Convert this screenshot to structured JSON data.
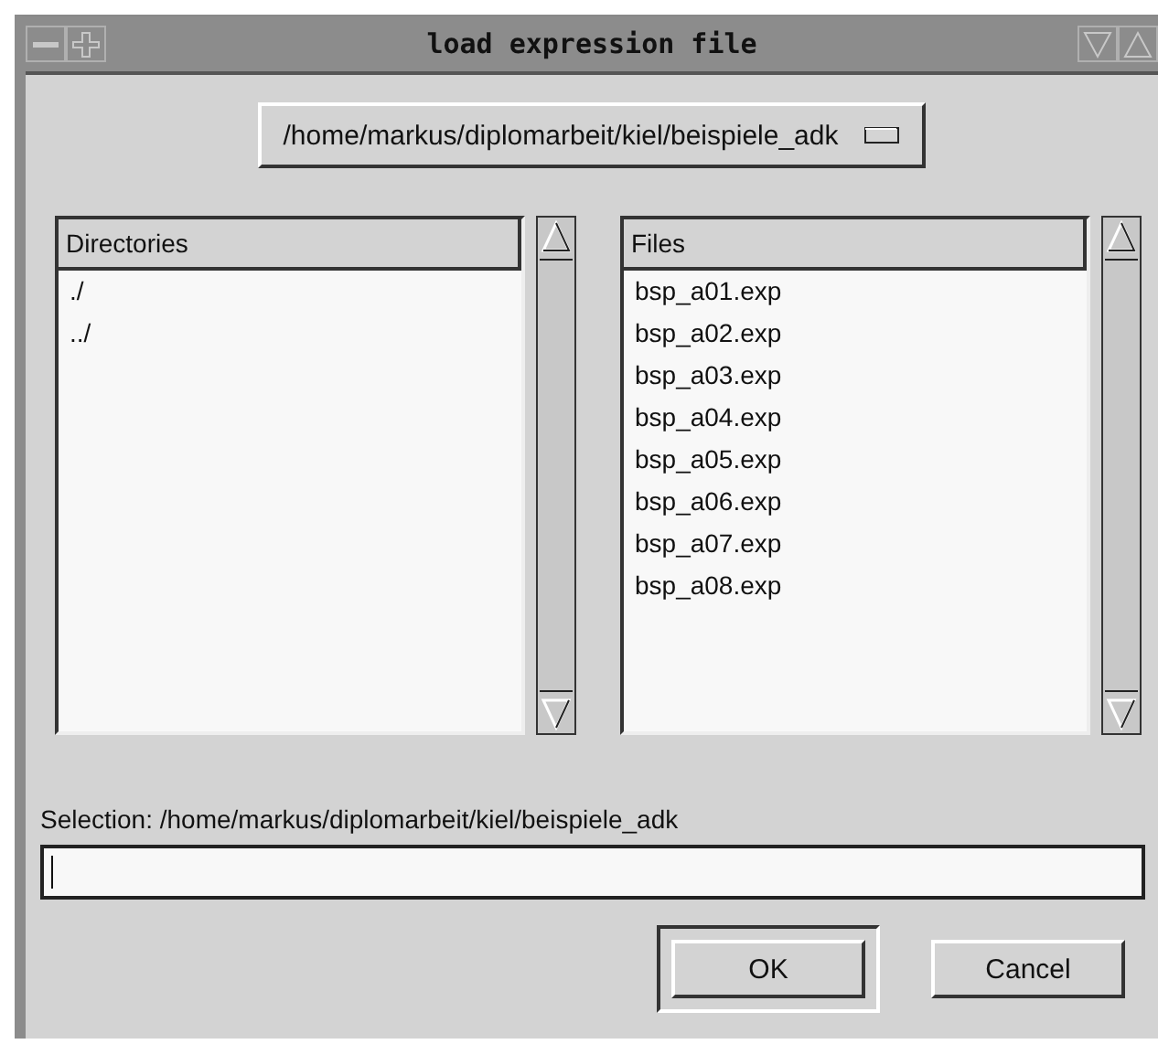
{
  "window": {
    "title": "load expression file"
  },
  "path_menu": {
    "value": "/home/markus/diplomarbeit/kiel/beispiele_adk"
  },
  "directories": {
    "heading": "Directories",
    "items": [
      "./",
      "../"
    ]
  },
  "files": {
    "heading": "Files",
    "items": [
      "bsp_a01.exp",
      "bsp_a02.exp",
      "bsp_a03.exp",
      "bsp_a04.exp",
      "bsp_a05.exp",
      "bsp_a06.exp",
      "bsp_a07.exp",
      "bsp_a08.exp"
    ]
  },
  "selection": {
    "label": "Selection: /home/markus/diplomarbeit/kiel/beispiele_adk"
  },
  "buttons": [
    {
      "label": "OK",
      "default": true
    },
    {
      "label": "Cancel",
      "default": false
    }
  ]
}
